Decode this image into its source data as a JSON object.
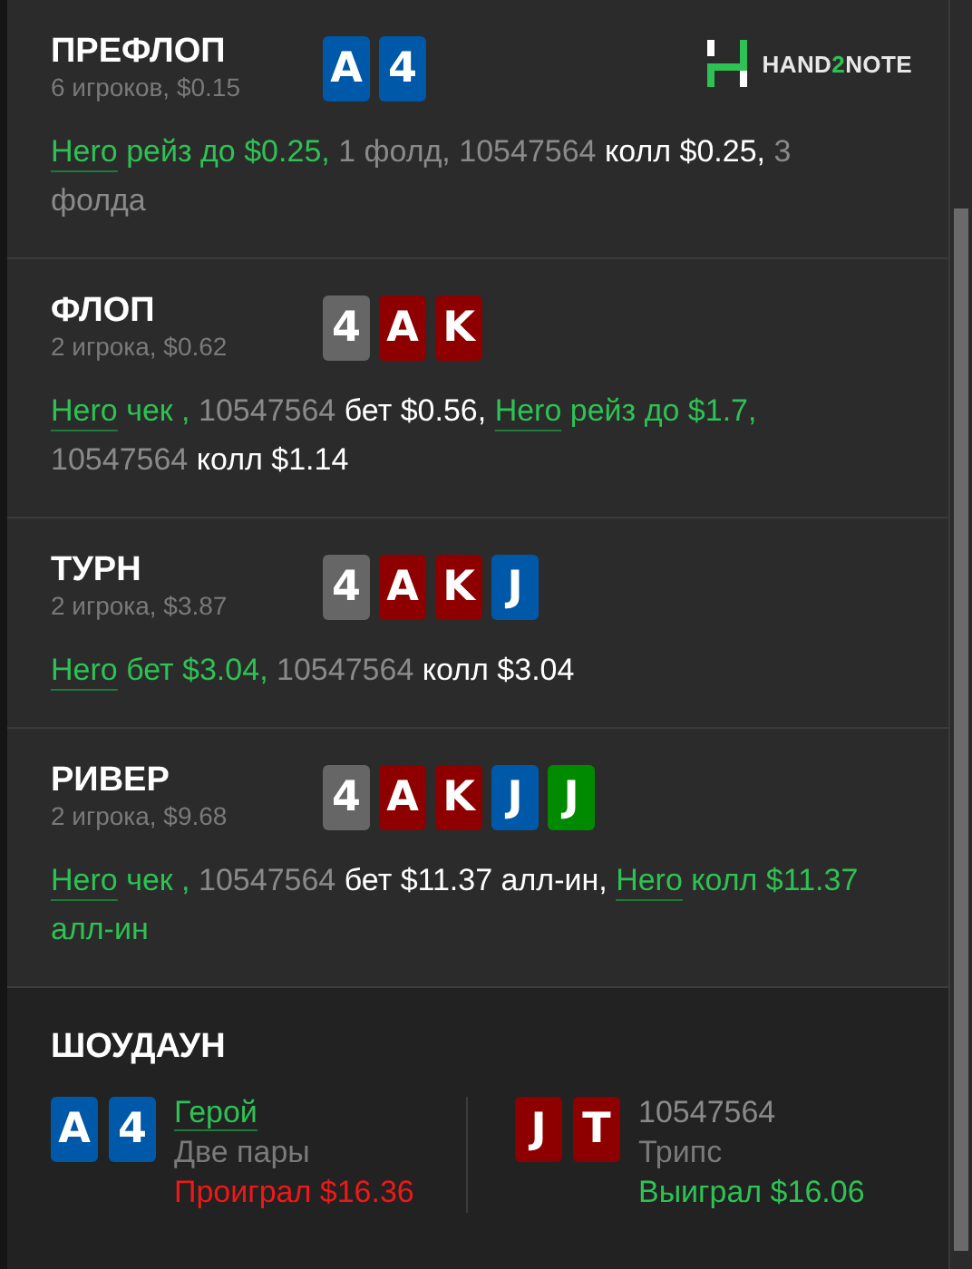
{
  "logo": {
    "parts": [
      {
        "text": "HAND",
        "accent": false
      },
      {
        "text": "2",
        "accent": true
      },
      {
        "text": "NOTE",
        "accent": false
      }
    ]
  },
  "streets": [
    {
      "title": "ПРЕФЛОП",
      "subtitle": "6 игроков, $0.15",
      "cards": [
        {
          "rank": "A",
          "color": "#0058a8"
        },
        {
          "rank": "4",
          "color": "#0058a8"
        }
      ],
      "actions": [
        {
          "kind": "hero",
          "text": "Hero"
        },
        {
          "kind": "hero_text",
          "text": " рейз до $0.25,"
        },
        {
          "kind": "muted",
          "text": " 1 фолд, 10547564"
        },
        {
          "kind": "action",
          "text": " колл $0.25,"
        },
        {
          "kind": "muted",
          "text": " 3 фолда"
        }
      ]
    },
    {
      "title": "ФЛОП",
      "subtitle": "2 игрока, $0.62",
      "cards": [
        {
          "rank": "4",
          "color": "#666666"
        },
        {
          "rank": "A",
          "color": "#8e0000"
        },
        {
          "rank": "K",
          "color": "#8e0000"
        }
      ],
      "actions": [
        {
          "kind": "hero",
          "text": "Hero"
        },
        {
          "kind": "hero_text",
          "text": " чек ,"
        },
        {
          "kind": "muted",
          "text": " 10547564"
        },
        {
          "kind": "action",
          "text": " бет $0.56, "
        },
        {
          "kind": "hero",
          "text": "Hero"
        },
        {
          "kind": "hero_text",
          "text": " рейз до $1.7,"
        },
        {
          "kind": "muted",
          "text": " 10547564"
        },
        {
          "kind": "action",
          "text": " колл $1.14"
        }
      ]
    },
    {
      "title": "ТУРН",
      "subtitle": "2 игрока, $3.87",
      "cards": [
        {
          "rank": "4",
          "color": "#666666"
        },
        {
          "rank": "A",
          "color": "#8e0000"
        },
        {
          "rank": "K",
          "color": "#8e0000"
        },
        {
          "rank": "J",
          "color": "#0058a8"
        }
      ],
      "actions": [
        {
          "kind": "hero",
          "text": "Hero"
        },
        {
          "kind": "hero_text",
          "text": " бет $3.04,"
        },
        {
          "kind": "muted",
          "text": " 10547564"
        },
        {
          "kind": "action",
          "text": " колл $3.04"
        }
      ]
    },
    {
      "title": "РИВЕР",
      "subtitle": "2 игрока, $9.68",
      "cards": [
        {
          "rank": "4",
          "color": "#666666"
        },
        {
          "rank": "A",
          "color": "#8e0000"
        },
        {
          "rank": "K",
          "color": "#8e0000"
        },
        {
          "rank": "J",
          "color": "#0058a8"
        },
        {
          "rank": "J",
          "color": "#008a00"
        }
      ],
      "actions": [
        {
          "kind": "hero",
          "text": "Hero"
        },
        {
          "kind": "hero_text",
          "text": " чек ,"
        },
        {
          "kind": "muted",
          "text": " 10547564"
        },
        {
          "kind": "action",
          "text": " бет $11.37 алл-ин, "
        },
        {
          "kind": "hero",
          "text": "Hero"
        },
        {
          "kind": "hero_text",
          "text": " колл $11.37 алл-ин"
        }
      ]
    }
  ],
  "showdown": {
    "title": "ШОУДАУН",
    "players": [
      {
        "name": "Герой",
        "hero": true,
        "hand": "Две пары",
        "result": "Проиграл $16.36",
        "won": false,
        "cards": [
          {
            "rank": "A",
            "color": "#0058a8"
          },
          {
            "rank": "4",
            "color": "#0058a8"
          }
        ]
      },
      {
        "name": "10547564",
        "hero": false,
        "hand": "Трипс",
        "result": "Выиграл $16.06",
        "won": true,
        "cards": [
          {
            "rank": "J",
            "color": "#8e0000"
          },
          {
            "rank": "T",
            "color": "#8e0000"
          }
        ]
      }
    ]
  }
}
